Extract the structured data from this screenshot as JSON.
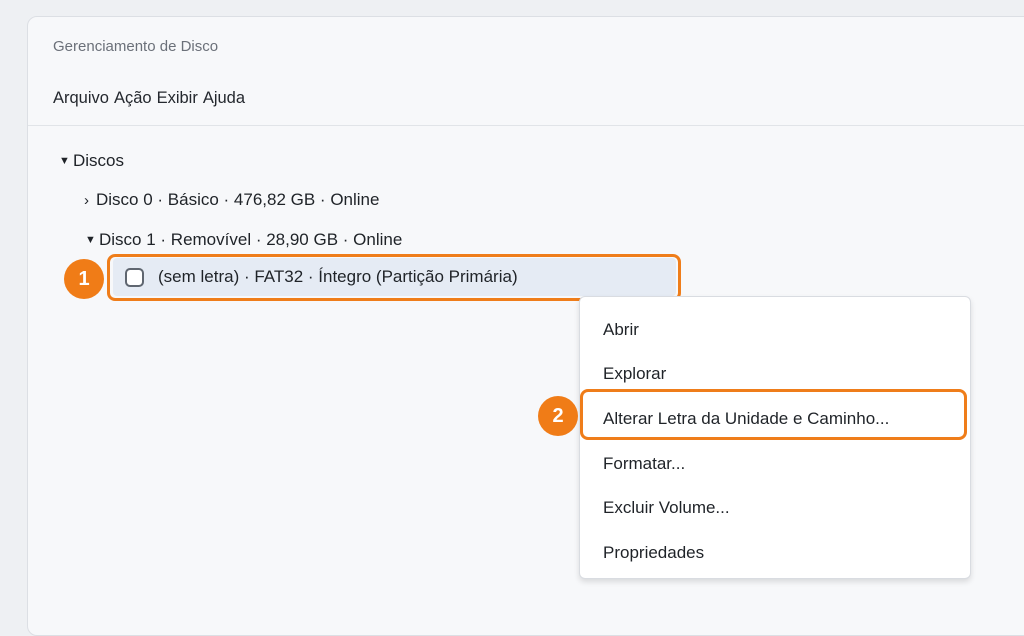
{
  "window": {
    "title": "Gerenciamento de Disco"
  },
  "menubar": {
    "items": [
      "Arquivo",
      "Ação",
      "Exibir",
      "Ajuda"
    ]
  },
  "tree": {
    "root_label": "Discos",
    "disks": [
      {
        "label": "Disco 0 · Básico · 476,82 GB · Online",
        "expanded": false
      },
      {
        "label": "Disco 1 · Removível · 28,90 GB · Online",
        "expanded": true
      }
    ],
    "partition_label": "(sem letra) · FAT32 · Íntegro (Partição Primária)"
  },
  "context_menu": {
    "items": [
      "Abrir",
      "Explorar",
      "Alterar Letra da Unidade e Caminho...",
      "Formatar...",
      "Excluir Volume...",
      "Propriedades"
    ]
  },
  "annotations": {
    "step1": "1",
    "step2": "2",
    "accent_color": "#f07c17"
  }
}
